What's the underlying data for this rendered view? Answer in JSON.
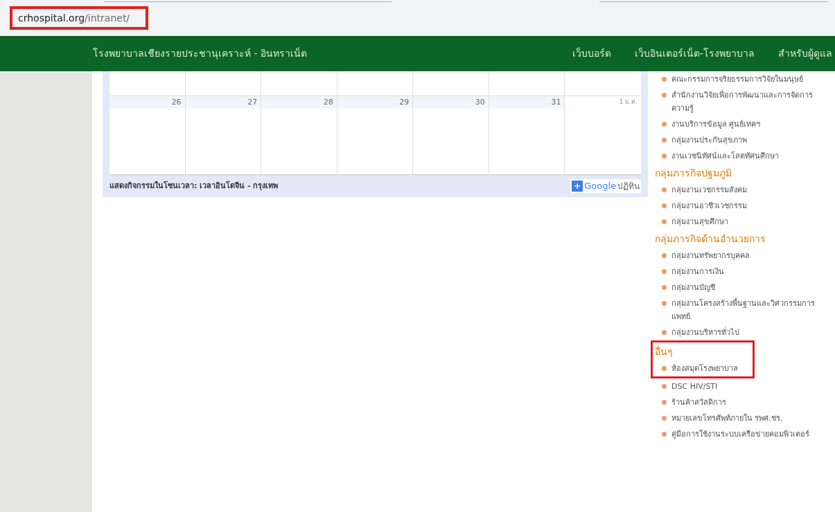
{
  "address_bar": {
    "url_host": "crhospital.org",
    "url_path": "/intranet/",
    "highlighted": true
  },
  "header": {
    "site_title": "โรงพยาบาลเชียงรายประชานุเคราะห์ - อินทราเน็ต",
    "nav": [
      "เว็บบอร์ด",
      "เว็บอินเตอร์เน็ต-โรงพยาบาล",
      "สำหรับผู้ดูแล"
    ]
  },
  "calendar": {
    "days": [
      {
        "label": "26",
        "current_month": true
      },
      {
        "label": "27",
        "current_month": true
      },
      {
        "label": "28",
        "current_month": true
      },
      {
        "label": "29",
        "current_month": true
      },
      {
        "label": "30",
        "current_month": true
      },
      {
        "label": "31",
        "current_month": true
      },
      {
        "label": "1 ม.ค.",
        "current_month": false
      }
    ],
    "timezone_note": "แสดงกิจกรรมในโซนเวลา: เวลาอินโดจีน - กรุงเทพ",
    "add_button": {
      "plus": "+",
      "brand": "Google",
      "label": "ปฏิทิน"
    }
  },
  "sidebar": [
    {
      "kind": "item",
      "text": "คณะกรรมการจริยธรรมการวิจัยในมนุษย์",
      "highlighted": false
    },
    {
      "kind": "item",
      "text": "สำนักงานวิจัยเพื่อการพัฒนาและการจัดการความรู้",
      "highlighted": false
    },
    {
      "kind": "item",
      "text": "งานบริการข้อมูล ศูนย์เทคฯ",
      "highlighted": false
    },
    {
      "kind": "item",
      "text": "กลุ่มงานประกันสุขภาพ",
      "highlighted": false
    },
    {
      "kind": "item",
      "text": "งานเวชนิทัศน์และโสตทัศนศึกษา",
      "highlighted": false
    },
    {
      "kind": "heading",
      "text": "กลุ่มภารกิจปฐมภูมิ",
      "highlighted": false
    },
    {
      "kind": "item",
      "text": "กลุ่มงานเวชกรรมสังคม",
      "highlighted": false
    },
    {
      "kind": "item",
      "text": "กลุ่มงานอาชีวเวชกรรม",
      "highlighted": false
    },
    {
      "kind": "item",
      "text": "กลุ่มงานสุขศึกษา",
      "highlighted": false
    },
    {
      "kind": "heading",
      "text": "กลุ่มภารกิจด้านอำนวยการ",
      "highlighted": false
    },
    {
      "kind": "item",
      "text": "กลุ่มงานทรัพยากรบุคคล",
      "highlighted": false
    },
    {
      "kind": "item",
      "text": "กลุ่มงานการเงิน",
      "highlighted": false
    },
    {
      "kind": "item",
      "text": "กลุ่มงานบัญชี",
      "highlighted": false
    },
    {
      "kind": "item",
      "text": "กลุ่มงานโครงสร้างพื้นฐานและวิศวกรรมการแพทย์",
      "highlighted": false
    },
    {
      "kind": "item",
      "text": "กลุ่มงานบริหารทั่วไป",
      "highlighted": false
    },
    {
      "kind": "heading",
      "text": "อื่นๆ",
      "highlighted": true
    },
    {
      "kind": "item",
      "text": "ห้องสมุดโรงพยาบาล",
      "highlighted": true
    },
    {
      "kind": "item",
      "text": "DSC HIV/STI",
      "highlighted": false
    },
    {
      "kind": "item",
      "text": "ร้านค้าสวัสดิการ",
      "highlighted": false
    },
    {
      "kind": "item",
      "text": "หมายเลขโทรศัพท์ภายใน รพศ.ชร.",
      "highlighted": false
    },
    {
      "kind": "item",
      "text": "คู่มือการใช้งานระบบเครือข่ายคอมพิวเตอร์",
      "highlighted": false
    }
  ]
}
